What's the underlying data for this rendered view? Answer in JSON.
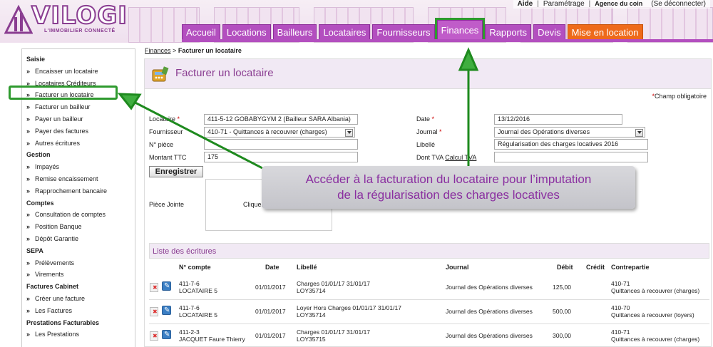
{
  "brand": {
    "logo_text": "VILOGI",
    "logo_sub": "L'IMMOBILIER CONNECTÉ"
  },
  "toplinks": {
    "help": "Aide",
    "settings": "Paramétrage",
    "user": "Agence du coin",
    "logout": "(Se déconnecter)",
    "sep": "|"
  },
  "nav": {
    "tabs": [
      {
        "label": "Accueil"
      },
      {
        "label": "Locations"
      },
      {
        "label": "Bailleurs"
      },
      {
        "label": "Locataires"
      },
      {
        "label": "Fournisseurs"
      },
      {
        "label": "Finances"
      },
      {
        "label": "Rapports"
      },
      {
        "label": "Devis"
      },
      {
        "label": "Mise en location"
      }
    ]
  },
  "sidebar": {
    "groups": {
      "saisie": "Saisie",
      "gestion": "Gestion",
      "comptes": "Comptes",
      "sepa": "SEPA",
      "factures": "Factures Cabinet",
      "prestations": "Prestations Facturables"
    },
    "items": {
      "encaisser": "Encaisser un locataire",
      "crediteurs": "Locataires Créditeurs",
      "facturer_loc": "Facturer un locataire",
      "facturer_bail": "Facturer un bailleur",
      "payer_bail": "Payer un bailleur",
      "payer_fact": "Payer des factures",
      "autres": "Autres écritures",
      "impayes": "Impayés",
      "remise": "Remise encaissement",
      "rappro": "Rapprochement bancaire",
      "consult": "Consultation de comptes",
      "position": "Position Banque",
      "depot": "Dépôt Garantie",
      "prelev": "Prélèvements",
      "virements": "Virements",
      "creer_fact": "Créer une facture",
      "les_fact": "Les Factures",
      "les_prest": "Les Prestations"
    }
  },
  "breadcrumb": {
    "parent": "Finances",
    "sep": ">",
    "current": "Facturer un locataire"
  },
  "page": {
    "title": "Facturer un locataire",
    "required_note": "Champ obligatoire",
    "star": "*"
  },
  "form": {
    "locataire_label": "Locataire",
    "locataire_value": "411-5-12 GOBABYGYM 2  (Bailleur SARA Albania)",
    "fournisseur_label": "Fournisseur",
    "fournisseur_value": "410-71 - Quittances à recouvrer (charges)",
    "piece_label": "N° pièce",
    "piece_value": "",
    "montant_label": "Montant TTC",
    "montant_value": "175",
    "date_label": "Date",
    "date_value": "13/12/2016",
    "journal_label": "Journal",
    "journal_value": "Journal des Opérations diverses",
    "libelle_label": "Libellé",
    "libelle_value": "Régularisation des charges locatives 2016",
    "tva_label": "Dont TVA",
    "tva_link": "Calcul TVA",
    "tva_value": "",
    "save": "Enregistrer",
    "attachment_label": "Pièce Jointe",
    "attachment_drop": "Cliquer"
  },
  "list": {
    "title": "Liste des écritures",
    "columns": {
      "compte": "N° compte",
      "date": "Date",
      "libelle": "Libellé",
      "journal": "Journal",
      "debit": "Débit",
      "credit": "Crédit",
      "contrepartie": "Contrepartie"
    },
    "rows": [
      {
        "compte": "411-7-6",
        "nom": "LOCATAIRE 5",
        "date": "01/01/2017",
        "lib1": "Charges 01/01/17 31/01/17",
        "lib2": "LOY35714",
        "journal": "Journal des Opérations diverses",
        "debit": "125,00",
        "credit": "",
        "cp1": "410-71",
        "cp2": "Quittances à recouvrer (charges)"
      },
      {
        "compte": "411-7-6",
        "nom": "LOCATAIRE 5",
        "date": "01/01/2017",
        "lib1": "Loyer Hors Charges 01/01/17 31/01/17",
        "lib2": "LOY35714",
        "journal": "Journal des Opérations diverses",
        "debit": "500,00",
        "credit": "",
        "cp1": "410-70",
        "cp2": "Quittances à recouvrer (loyers)"
      },
      {
        "compte": "411-2-3",
        "nom": "JACQUET Faure Thierry",
        "date": "01/01/2017",
        "lib1": "Charges 01/01/17 31/01/17",
        "lib2": "LOY35715",
        "journal": "Journal des Opérations diverses",
        "debit": "300,00",
        "credit": "",
        "cp1": "410-71",
        "cp2": "Quittances à recouvrer (charges)"
      }
    ]
  },
  "callout": {
    "line1": "Accéder à la facturation du locataire pour l’imputation",
    "line2": "de la régularisation des charges locatives"
  },
  "colors": {
    "brand": "#8a3d91",
    "tab": "#b34fbf",
    "tab_orange": "#ee6a1a",
    "highlight": "#2e9a2e",
    "callout_text": "#8a2fa0"
  }
}
